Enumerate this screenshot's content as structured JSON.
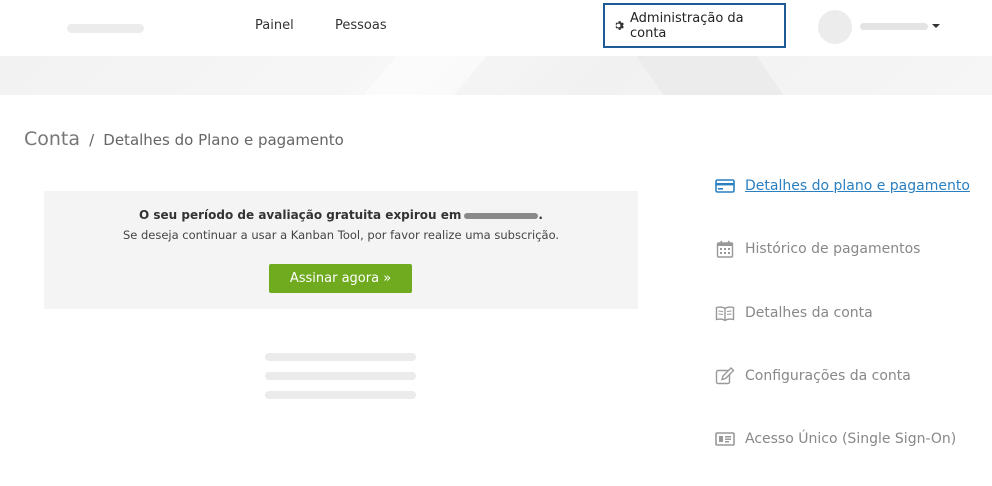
{
  "header": {
    "nav": [
      {
        "label": "Painel"
      },
      {
        "label": "Pessoas"
      }
    ],
    "admin_button": {
      "label": "Administração da conta",
      "icon": "gear-icon"
    }
  },
  "breadcrumb": {
    "root": "Conta",
    "separator": "/",
    "current": "Detalhes do Plano e pagamento"
  },
  "notice": {
    "line1_prefix": "O seu período de avaliação gratuita expirou em",
    "line1_suffix": ".",
    "line2": "Se deseja continuar a usar a Kanban Tool, por favor realize uma subscrição.",
    "button_label": "Assinar agora »"
  },
  "side_menu": [
    {
      "label": "Detalhes do plano e pagamento",
      "icon": "credit-card-icon",
      "active": true
    },
    {
      "label": "Histórico de pagamentos",
      "icon": "calendar-icon",
      "active": false
    },
    {
      "label": "Detalhes da conta",
      "icon": "book-icon",
      "active": false
    },
    {
      "label": "Configurações da conta",
      "icon": "edit-icon",
      "active": false
    },
    {
      "label": "Acesso Único (Single Sign-On)",
      "icon": "id-card-icon",
      "active": false
    }
  ],
  "colors": {
    "accent_border": "#1c5b95",
    "button_green": "#6faa1f",
    "active_link": "#2a7fc0",
    "menu_gray": "#888888"
  }
}
